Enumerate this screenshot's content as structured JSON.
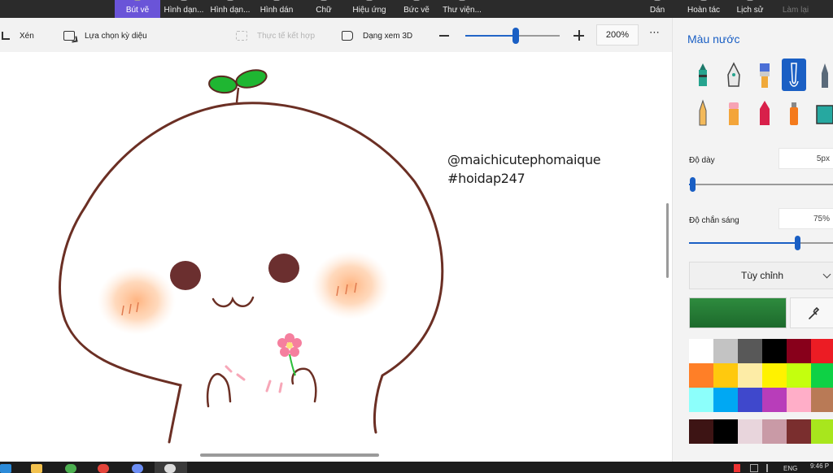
{
  "ribbon": {
    "tabs": [
      {
        "label": "Bút vẽ",
        "active": true
      },
      {
        "label": "Hình dạn..."
      },
      {
        "label": "Hình dạn..."
      },
      {
        "label": "Hình dán"
      },
      {
        "label": "Chữ"
      },
      {
        "label": "Hiệu ứng"
      },
      {
        "label": "Bức vẽ"
      },
      {
        "label": "Thư viện..."
      }
    ],
    "right": [
      {
        "label": "Dán"
      },
      {
        "label": "Hoàn tác"
      },
      {
        "label": "Lịch sử"
      },
      {
        "label": "Làm lại",
        "disabled": true
      }
    ]
  },
  "toolbar": {
    "crop": "Xén",
    "magic_select": "Lựa chọn kỳ diệu",
    "mixed_reality": "Thực tế kết hợp",
    "view_3d": "Dạng xem 3D",
    "zoom_value": "200%",
    "zoom_level": 0.53,
    "more": "⋯"
  },
  "canvas": {
    "watermark_line1": "@maichicutephomaique",
    "watermark_line2": "#hoidap247"
  },
  "panel": {
    "title": "Màu nước",
    "brushes": [
      "marker-icon",
      "calligraphy-pen-icon",
      "oil-brush-icon",
      "watercolor-brush-icon",
      "pixel-pen-icon",
      "pencil-icon",
      "eraser-icon",
      "crayon-icon",
      "spray-can-icon",
      "fill-bucket-icon"
    ],
    "selected_brush": 3,
    "thickness_label": "Độ dày",
    "thickness_value": "5px",
    "thickness_level": 0.02,
    "opacity_label": "Độ chắn sáng",
    "opacity_value": "75%",
    "opacity_level": 0.74,
    "custom_label": "Tùy chỉnh",
    "current_color": "#2e8b3e",
    "palette": [
      [
        "#ffffff",
        "#c3c3c3",
        "#585858",
        "#000000",
        "#88001b",
        "#ec1c24"
      ],
      [
        "#ff7f27",
        "#ffc90e",
        "#fdeca6",
        "#fff200",
        "#c4ff0e",
        "#0ed145"
      ],
      [
        "#8cfffb",
        "#00a8f3",
        "#3f48cc",
        "#b83dba",
        "#ffaec8",
        "#b97a56"
      ],
      [
        "#3d1414",
        "#000000",
        "#e8d5dc",
        "#c99aa6",
        "#7a2e2e",
        "#a8e61d"
      ]
    ]
  },
  "taskbar": {
    "lang": "ENG",
    "time": "9:46 P"
  },
  "colors": {
    "accent": "#1a5fc4",
    "ribbon_bg": "#2b2b2b",
    "active_tab": "#6a54d8"
  }
}
